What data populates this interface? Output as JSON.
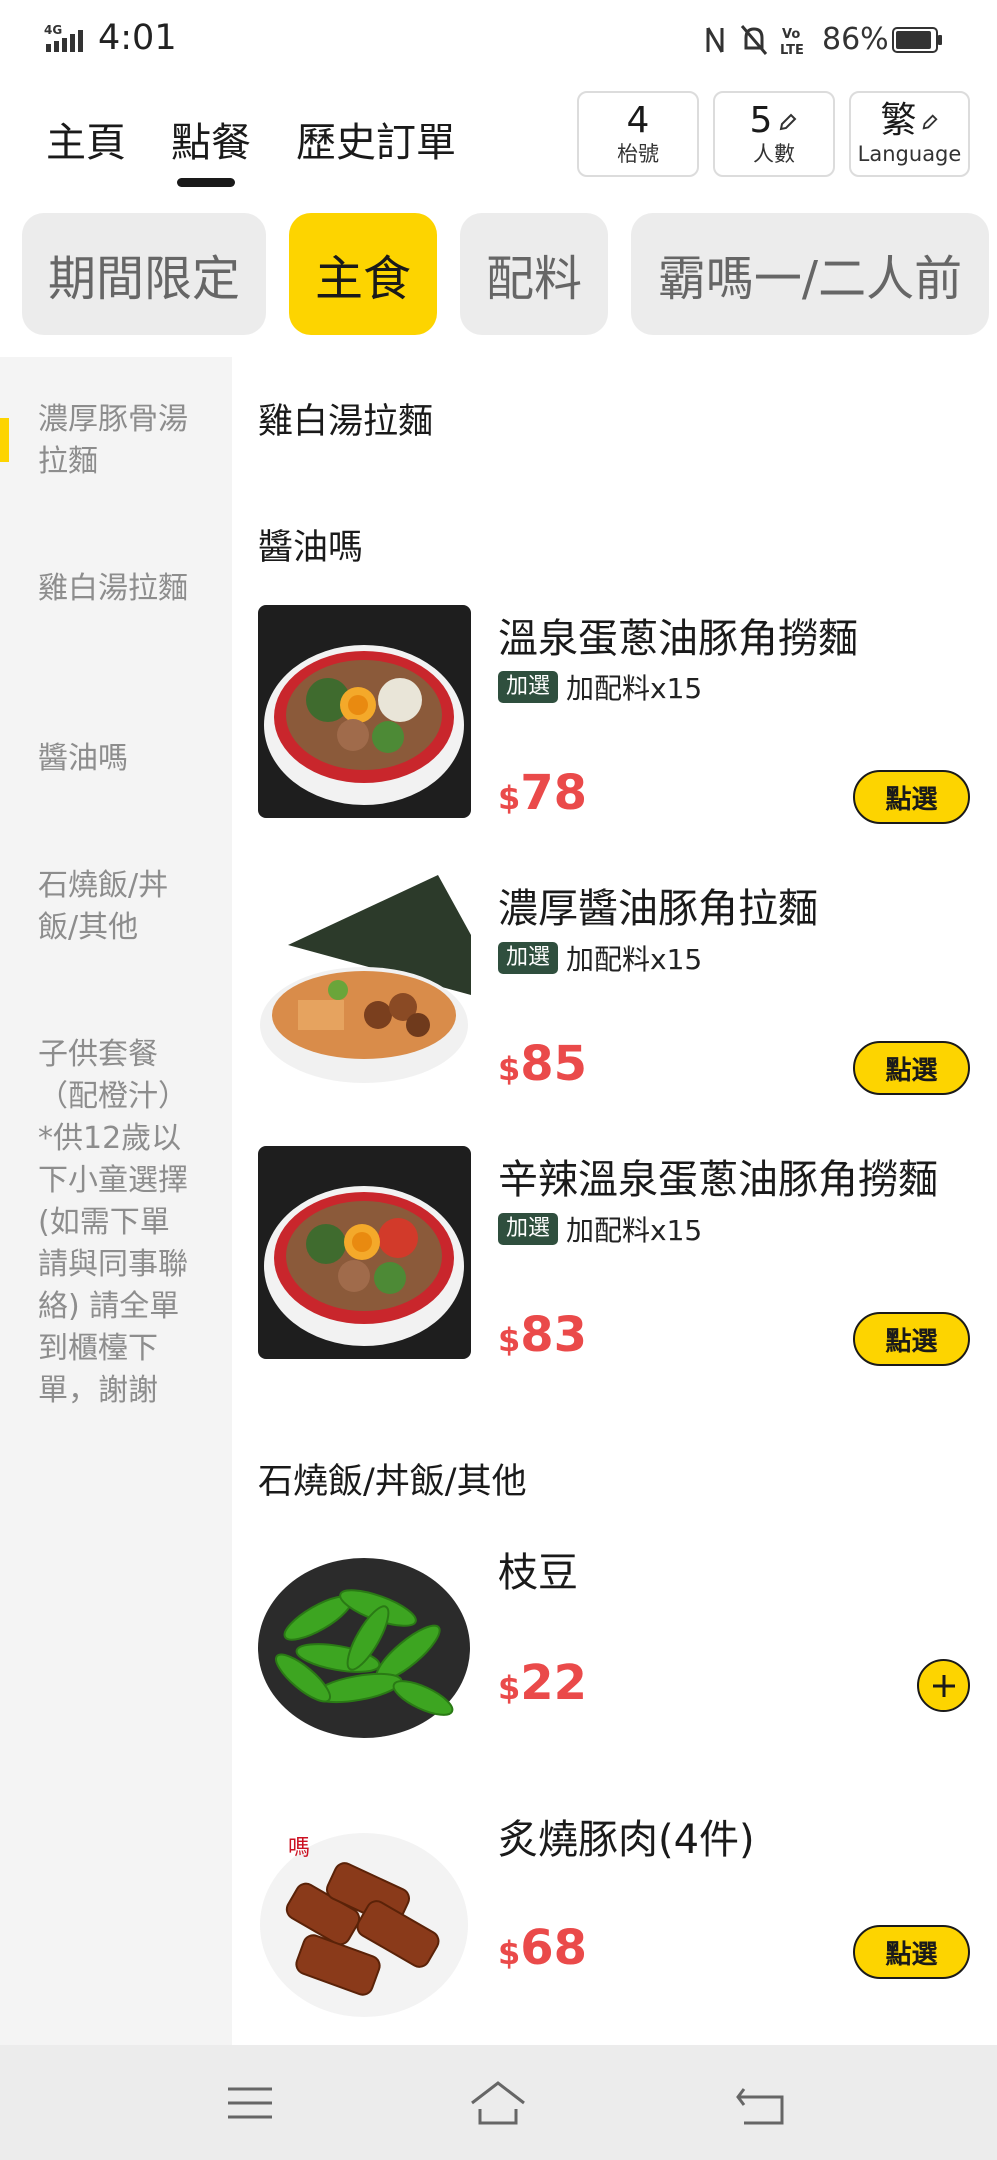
{
  "status_bar": {
    "network": "4G",
    "time": "4:01",
    "volte": "Vo LTE",
    "battery_pct": "86%"
  },
  "top_nav": {
    "tabs": [
      {
        "label": "主頁"
      },
      {
        "label": "點餐",
        "active": true
      },
      {
        "label": "歷史訂單"
      }
    ],
    "table_number": "4",
    "table_label": "枱號",
    "people_count": "5",
    "people_label": "人數",
    "lang_value": "繁",
    "lang_label": "Language"
  },
  "categories": [
    {
      "label": "期間限定"
    },
    {
      "label": "主食",
      "active": true
    },
    {
      "label": "配料"
    },
    {
      "label": "霸嗎一/二人前"
    }
  ],
  "sidebar": {
    "items": [
      {
        "label": "濃厚豚骨湯拉麵",
        "active": true
      },
      {
        "label": "雞白湯拉麵"
      },
      {
        "label": "醬油嗎"
      },
      {
        "label": "石燒飯/丼飯/其他"
      },
      {
        "label": "子供套餐（配橙汁）*供12歲以下小童選擇 (如需下單請與同事聯絡) 請全單到櫃檯下單，謝謝"
      }
    ]
  },
  "sections": [
    {
      "title": "雞白湯拉麵"
    },
    {
      "title": "醬油嗎"
    },
    {
      "title": "石燒飯/丼飯/其他"
    }
  ],
  "menu_items": [
    {
      "name": "溫泉蛋蔥油豚角撈麵",
      "tag": "加選",
      "tag_text": "加配料x15",
      "currency": "$",
      "price": "78",
      "button": "點選"
    },
    {
      "name": "濃厚醬油豚角拉麵",
      "tag": "加選",
      "tag_text": "加配料x15",
      "currency": "$",
      "price": "85",
      "button": "點選"
    },
    {
      "name": "辛辣溫泉蛋蔥油豚角撈麵",
      "tag": "加選",
      "tag_text": "加配料x15",
      "currency": "$",
      "price": "83",
      "button": "點選"
    },
    {
      "name": "枝豆",
      "currency": "$",
      "price": "22"
    },
    {
      "name": "炙燒豚肉(4件)",
      "currency": "$",
      "price": "68",
      "button": "點選"
    }
  ],
  "colors": {
    "accent_yellow": "#fdd400",
    "price_red": "#ea4a4a",
    "tag_green": "#2f4f3e"
  }
}
